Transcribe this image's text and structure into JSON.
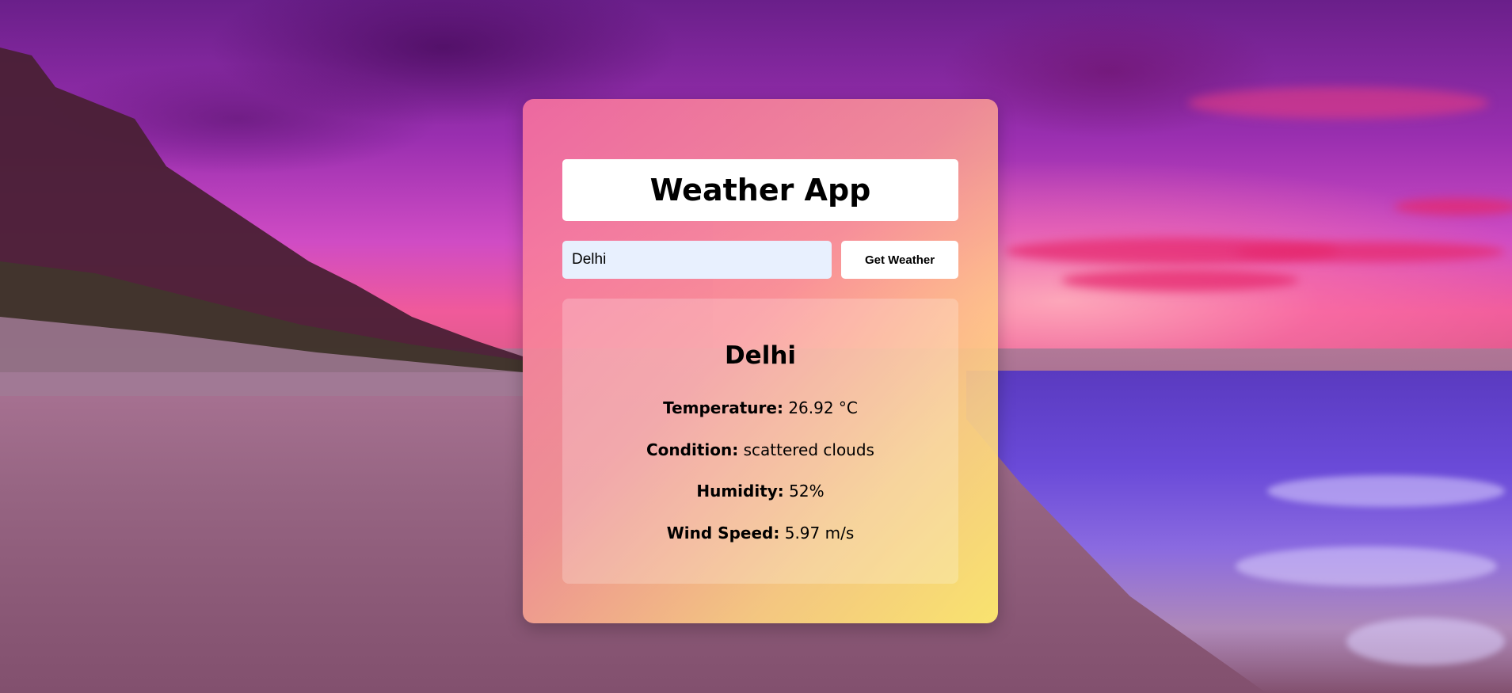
{
  "app": {
    "title": "Weather App"
  },
  "search": {
    "value": "Delhi",
    "button_label": "Get Weather"
  },
  "result": {
    "city": "Delhi",
    "temperature_label": "Temperature:",
    "temperature_value": "26.92 °C",
    "condition_label": "Condition:",
    "condition_value": "scattered clouds",
    "humidity_label": "Humidity:",
    "humidity_value": "52%",
    "wind_label": "Wind Speed:",
    "wind_value": "5.97 m/s"
  },
  "colors": {
    "card_gradient_start": "#f56ea0",
    "card_gradient_end": "#ffeb6e",
    "input_background": "#e8f0fe",
    "button_background": "#ffffff"
  },
  "icons": {
    "background": "sunset-beach-photo"
  }
}
